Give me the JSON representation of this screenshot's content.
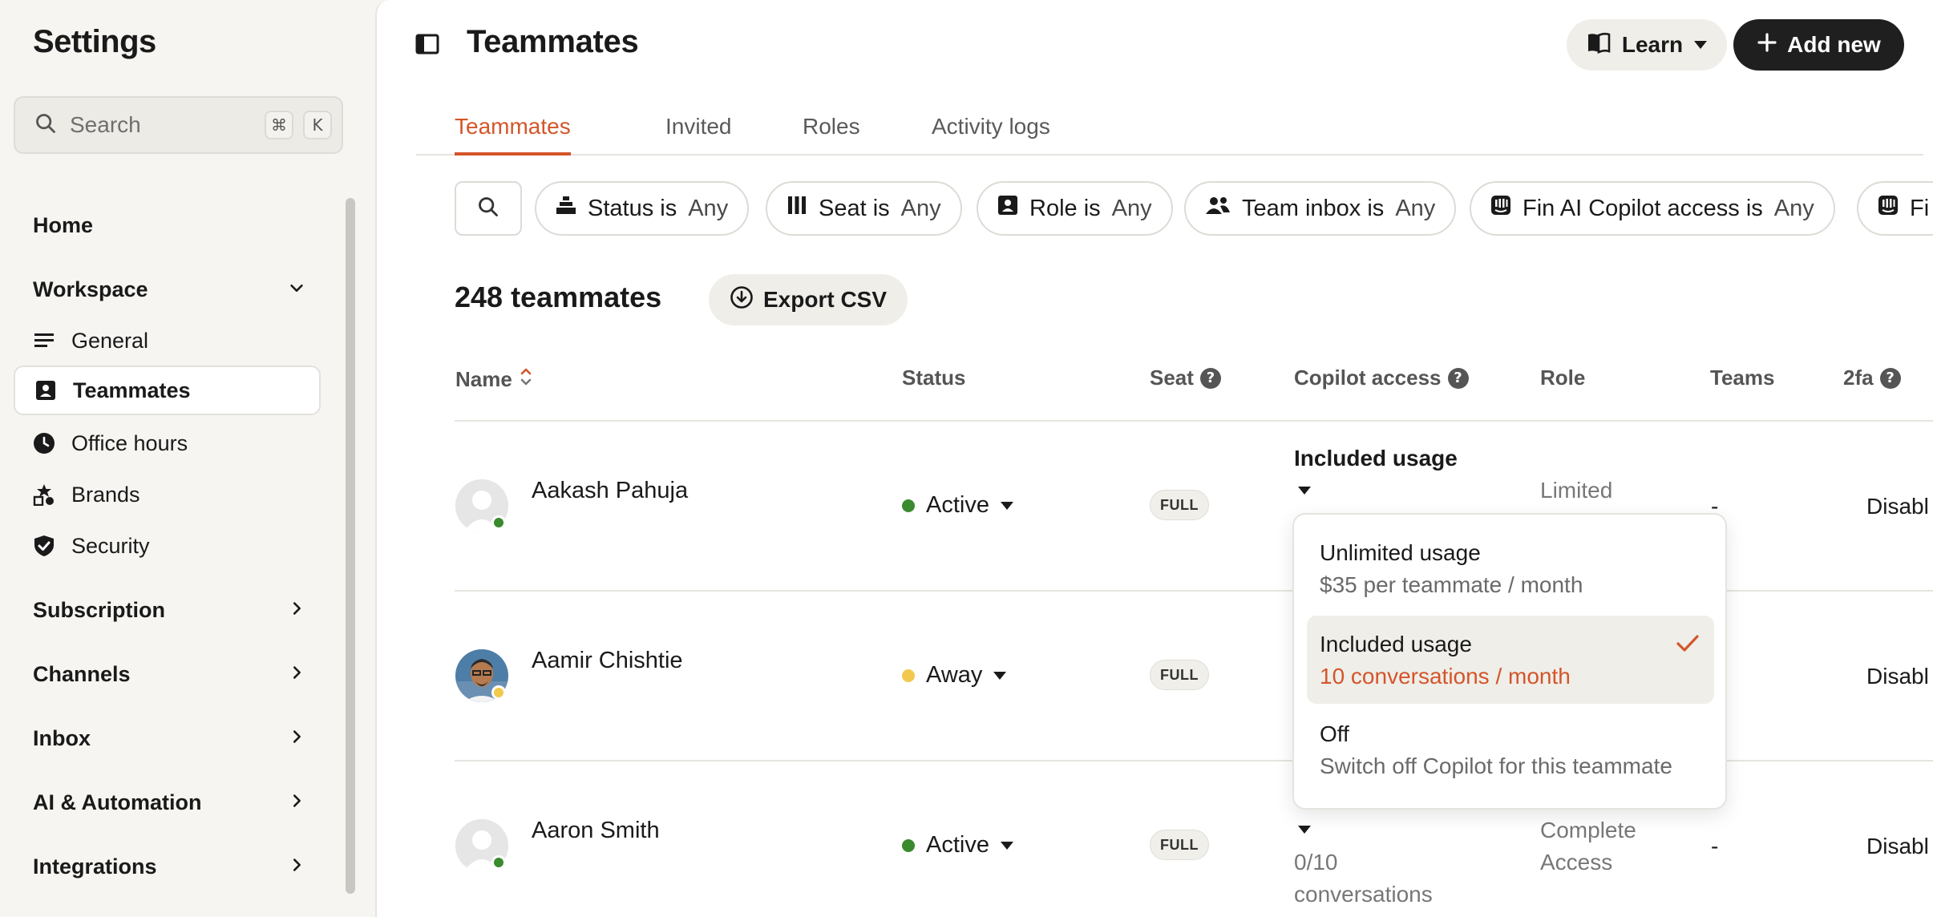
{
  "sidebar": {
    "title": "Settings",
    "search": {
      "placeholder": "Search",
      "shortcut_key1": "⌘",
      "shortcut_key2": "K"
    },
    "home": "Home",
    "workspace": {
      "label": "Workspace",
      "items": [
        {
          "label": "General",
          "icon": "list-icon"
        },
        {
          "label": "Teammates",
          "icon": "contact-card-icon",
          "active": true
        },
        {
          "label": "Office hours",
          "icon": "clock-icon"
        },
        {
          "label": "Brands",
          "icon": "shapes-icon"
        },
        {
          "label": "Security",
          "icon": "shield-check-icon"
        }
      ]
    },
    "sections": [
      "Subscription",
      "Channels",
      "Inbox",
      "AI & Automation",
      "Integrations"
    ]
  },
  "header": {
    "title": "Teammates",
    "learn_label": "Learn",
    "add_label": "Add new"
  },
  "tabs": [
    "Teammates",
    "Invited",
    "Roles",
    "Activity logs"
  ],
  "filters": [
    {
      "prefix": "Status is",
      "value": "Any",
      "icon": "status-icon"
    },
    {
      "prefix": "Seat is",
      "value": "Any",
      "icon": "seat-icon"
    },
    {
      "prefix": "Role is",
      "value": "Any",
      "icon": "role-icon"
    },
    {
      "prefix": "Team inbox is",
      "value": "Any",
      "icon": "team-icon"
    },
    {
      "prefix": "Fin AI Copilot access is",
      "value": "Any",
      "icon": "fin-icon"
    },
    {
      "prefix": "Fi",
      "value": "",
      "icon": "fin-icon"
    }
  ],
  "summary": {
    "count": "248 teammates",
    "export_label": "Export CSV"
  },
  "columns": [
    "Name",
    "Status",
    "Seat",
    "Copilot access",
    "Role",
    "Teams",
    "2fa"
  ],
  "rows": [
    {
      "name": "Aakash Pahuja",
      "status": "Active",
      "seat": "FULL",
      "copilot": "Included usage",
      "role": "Limited",
      "teams": "-",
      "twofa": "Disabl"
    },
    {
      "name": "Aamir Chishtie",
      "status": "Away",
      "seat": "FULL",
      "copilot": "",
      "role": "",
      "teams": "",
      "twofa": "Disabl"
    },
    {
      "name": "Aaron Smith",
      "status": "Active",
      "seat": "FULL",
      "copilot_line1": "0/10",
      "copilot_line2": "conversations",
      "role_line1": "Complete",
      "role_line2": "Access",
      "teams": "-",
      "twofa": "Disabl"
    }
  ],
  "copilot_dropdown": {
    "options": [
      {
        "title": "Unlimited usage",
        "subtitle": "$35 per teammate / month",
        "selected": false
      },
      {
        "title": "Included usage",
        "subtitle": "10 conversations / month",
        "selected": true
      },
      {
        "title": "Off",
        "subtitle": "Switch off Copilot for this teammate",
        "selected": false
      }
    ]
  },
  "colors": {
    "accent": "#d4552a",
    "active_status": "#3a8a2e",
    "away_status": "#f2c94c",
    "primary_button": "#1f1f1f"
  }
}
